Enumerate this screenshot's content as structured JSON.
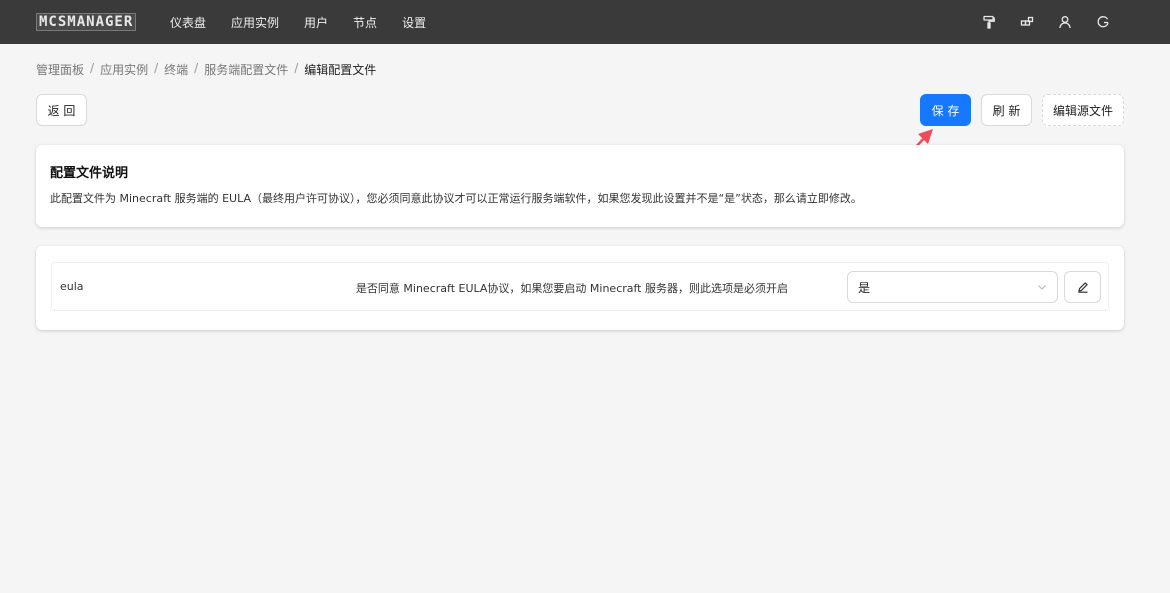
{
  "header": {
    "logo": "MCSMANAGER",
    "nav": [
      "仪表盘",
      "应用实例",
      "用户",
      "节点",
      "设置"
    ],
    "icons": [
      "paint-roller-icon",
      "deploy-icon",
      "user-icon",
      "logout-icon"
    ]
  },
  "breadcrumb": {
    "items": [
      "管理面板",
      "应用实例",
      "终端",
      "服务端配置文件"
    ],
    "current": "编辑配置文件"
  },
  "toolbar": {
    "back_label": "返 回",
    "save_label": "保 存",
    "refresh_label": "刷 新",
    "source_label": "编辑源文件"
  },
  "description": {
    "title": "配置文件说明",
    "text": "此配置文件为 Minecraft 服务端的 EULA（最终用户许可协议），您必须同意此协议才可以正常运行服务端软件，如果您发现此设置并不是“是”状态，那么请立即修改。"
  },
  "config": {
    "items": [
      {
        "key": "eula",
        "description": "是否同意 Minecraft EULA协议，如果您要启动 Minecraft 服务器，则此选项是必须开启",
        "value": "是"
      }
    ]
  },
  "colors": {
    "topbar": "#3a3a3a",
    "primary": "#1677ff",
    "annotation_arrow": "#ef4b5a"
  }
}
